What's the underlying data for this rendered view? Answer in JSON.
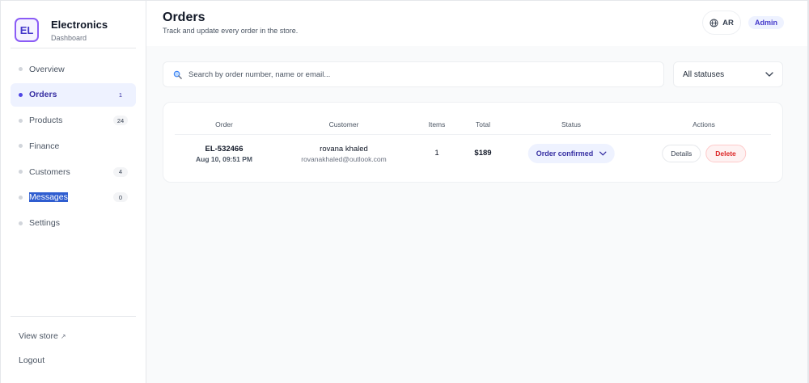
{
  "brand": {
    "logo": "EL",
    "name": "Electronics",
    "subtitle": "Dashboard"
  },
  "sidebar": {
    "items": [
      {
        "label": "Overview",
        "badge": ""
      },
      {
        "label": "Orders",
        "badge": "1"
      },
      {
        "label": "Products",
        "badge": "24"
      },
      {
        "label": "Finance",
        "badge": ""
      },
      {
        "label": "Customers",
        "badge": "4"
      },
      {
        "label": "Messages",
        "badge": "0"
      },
      {
        "label": "Settings",
        "badge": ""
      }
    ],
    "view_store": "View store",
    "view_store_icon": "↗",
    "logout": "Logout"
  },
  "header": {
    "title": "Orders",
    "subtitle": "Track and update every order in the store.",
    "lang": "AR",
    "role": "Admin"
  },
  "search": {
    "placeholder": "Search by order number, name or email...",
    "value": ""
  },
  "filter": {
    "selected": "All statuses"
  },
  "table": {
    "columns": [
      "Order",
      "Customer",
      "Items",
      "Total",
      "Status",
      "Actions"
    ],
    "rows": [
      {
        "order_id": "EL-532466",
        "date": "Aug 10, 09:51 PM",
        "customer_name": "rovana khaled",
        "customer_email": "rovanakhaled@outlook.com",
        "items": "1",
        "total": "$189",
        "status": "Order confirmed",
        "details_label": "Details",
        "delete_label": "Delete"
      }
    ]
  },
  "colors": {
    "accent": "#4f46e5",
    "danger": "#dc2626",
    "selection": "#2f5dd0"
  }
}
